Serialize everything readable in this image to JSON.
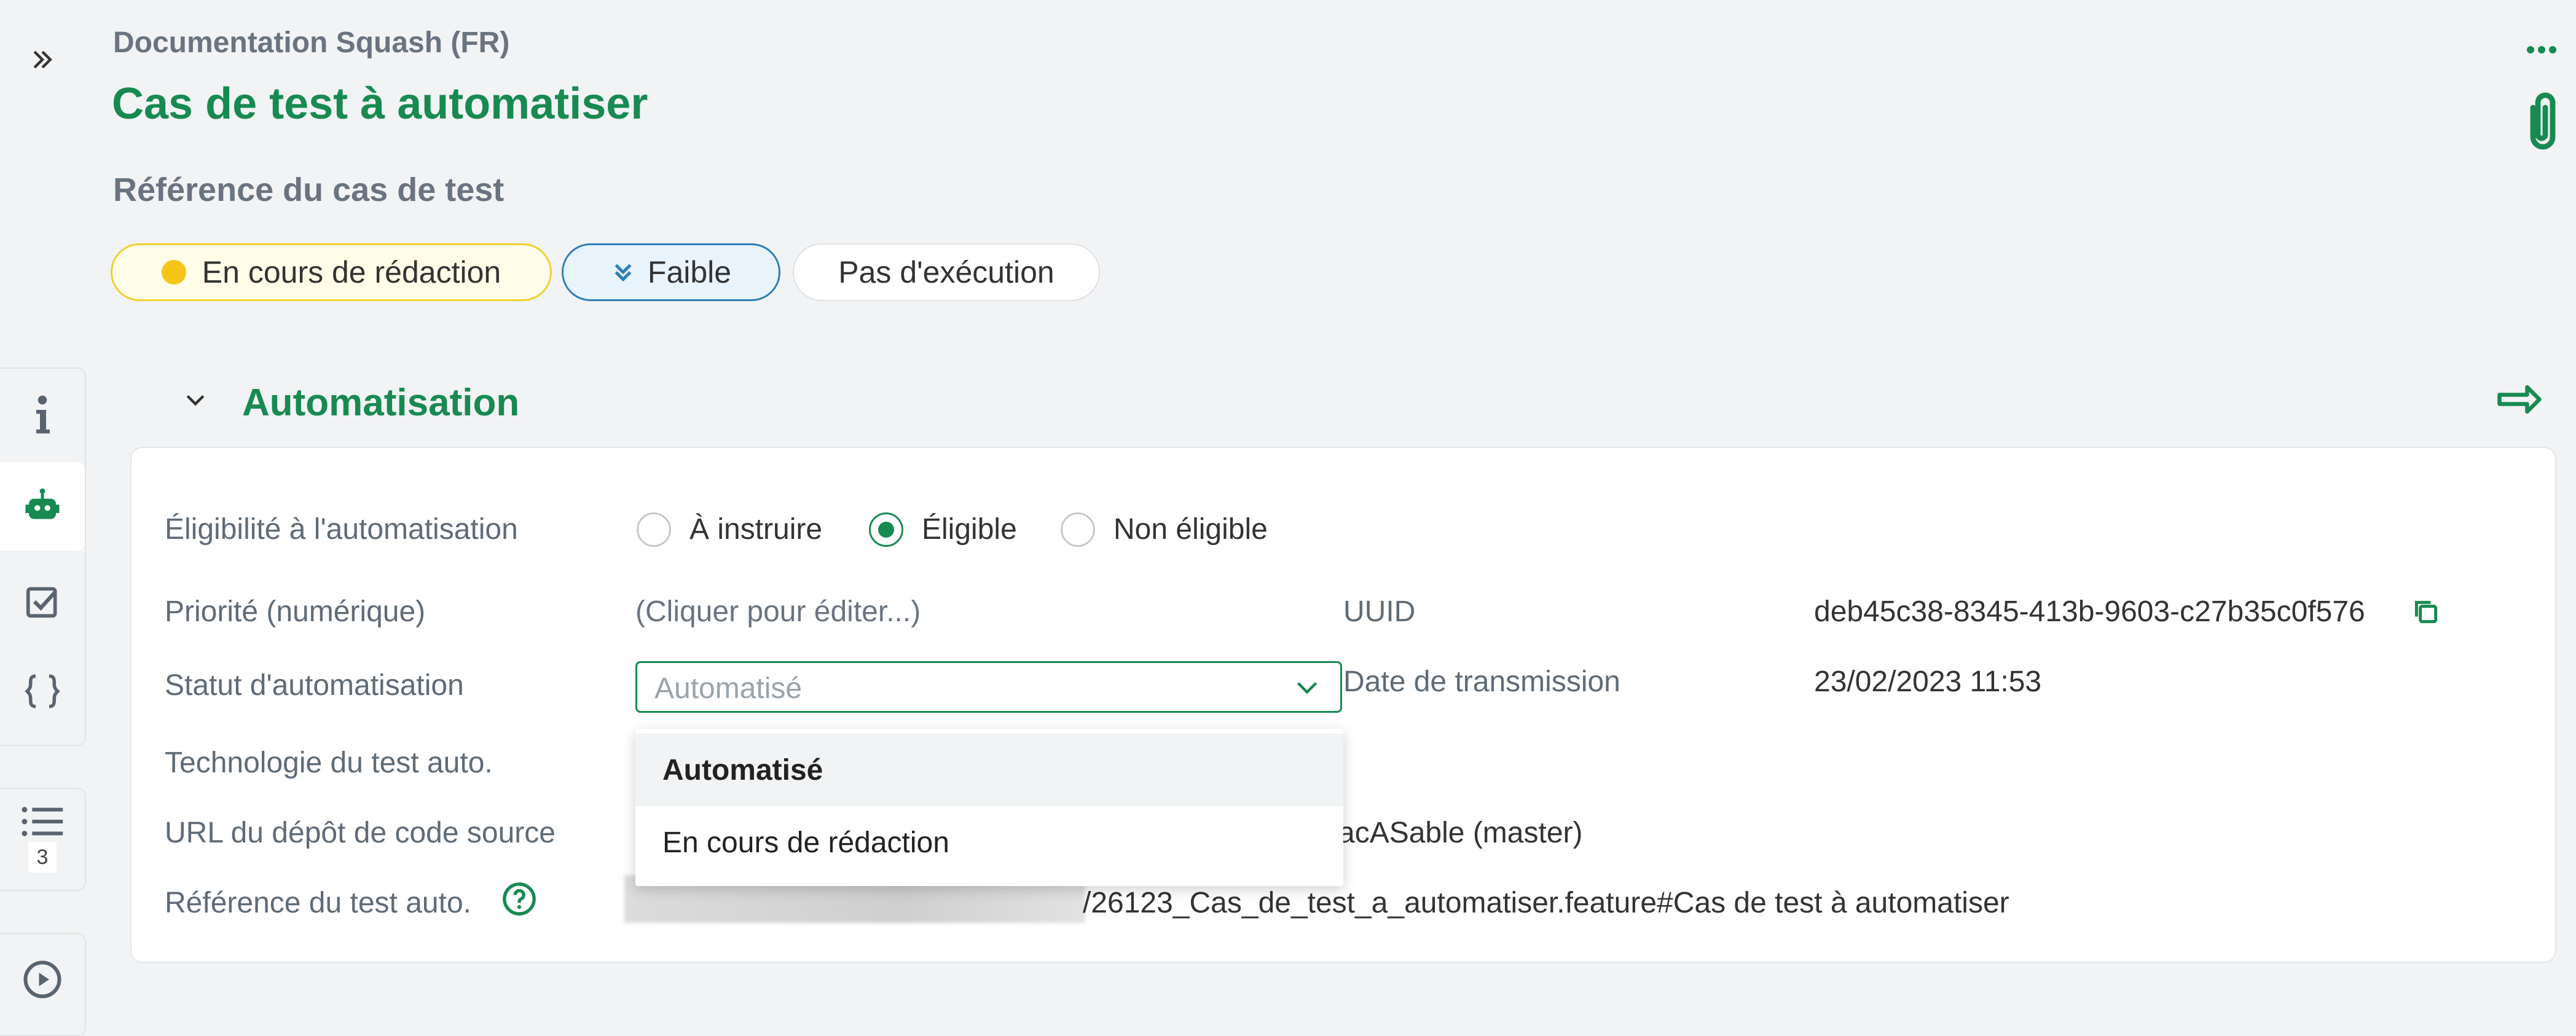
{
  "header": {
    "breadcrumb": "Documentation Squash (FR)",
    "title": "Cas de test à automatiser",
    "reference_label": "Référence du cas de test"
  },
  "pills": {
    "status": "En cours de rédaction",
    "importance": "Faible",
    "execution": "Pas d'exécution"
  },
  "rail": {
    "list_badge": "3"
  },
  "section": {
    "title": "Automatisation"
  },
  "fields": {
    "eligibility": {
      "label": "Éligibilité à l'automatisation",
      "options": [
        "À instruire",
        "Éligible",
        "Non éligible"
      ],
      "selected": "Éligible"
    },
    "priority": {
      "label": "Priorité (numérique)",
      "value": "(Cliquer pour éditer...)"
    },
    "uuid": {
      "label": "UUID",
      "value": "deb45c38-8345-413b-9603-c27b35c0f576"
    },
    "status": {
      "label": "Statut d'automatisation",
      "placeholder": "Automatisé"
    },
    "transmission": {
      "label": "Date de transmission",
      "value": "23/02/2023 11:53"
    },
    "technology": {
      "label": "Technologie du test auto."
    },
    "repo_url": {
      "label": "URL du dépôt de code source",
      "value": "acASable (master)"
    },
    "test_reference": {
      "label": "Référence du test auto.",
      "value": "/26123_Cas_de_test_a_automatiser.feature#Cas de test à automatiser"
    }
  },
  "dropdown": {
    "options": [
      "Automatisé",
      "En cours de rédaction"
    ]
  },
  "colors": {
    "accent": "#178a52",
    "status_dot": "#f5c518",
    "importance_blue": "#2d7fb8"
  },
  "icons": {
    "expand": "double-chevron-right-icon",
    "more": "more-dots-icon",
    "attachment": "paperclip-icon",
    "info": "info-icon",
    "robot": "robot-icon",
    "checklist": "checkbox-icon",
    "code": "braces-icon",
    "list": "list-icon",
    "play": "play-icon",
    "collapse": "chevron-down-icon",
    "goto": "arrow-right-icon",
    "copy": "copy-icon",
    "help": "help-icon"
  }
}
